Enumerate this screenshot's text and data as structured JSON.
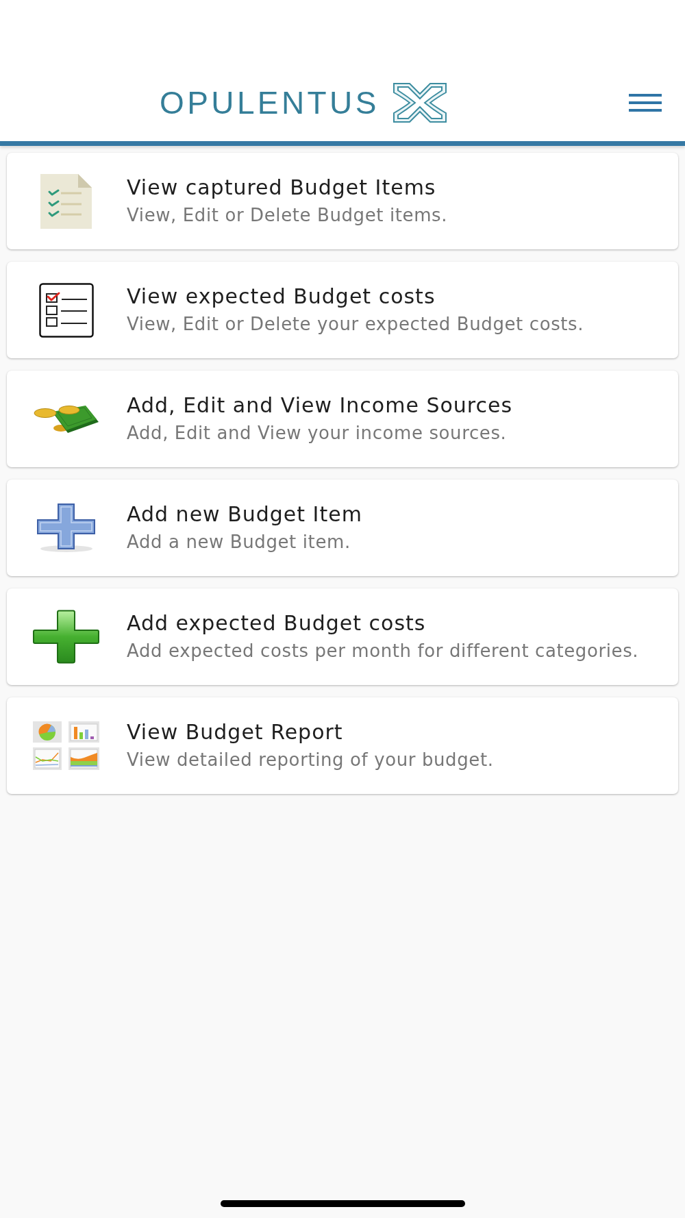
{
  "header": {
    "logo_text": "OPULENTUS"
  },
  "menu_items": [
    {
      "kind": "document",
      "title": "View captured Budget Items",
      "subtitle": "View, Edit or Delete Budget items."
    },
    {
      "kind": "checklist",
      "title": "View expected Budget costs",
      "subtitle": "View, Edit or Delete your expected Budget costs."
    },
    {
      "kind": "cash",
      "title": "Add, Edit and View Income Sources",
      "subtitle": "Add, Edit and View your income sources."
    },
    {
      "kind": "blueplus",
      "title": "Add new Budget Item",
      "subtitle": "Add a new Budget item."
    },
    {
      "kind": "greenplus",
      "title": "Add expected Budget costs",
      "subtitle": "Add expected costs per month for different categories."
    },
    {
      "kind": "charts",
      "title": "View Budget Report",
      "subtitle": "View detailed reporting of your budget."
    }
  ]
}
